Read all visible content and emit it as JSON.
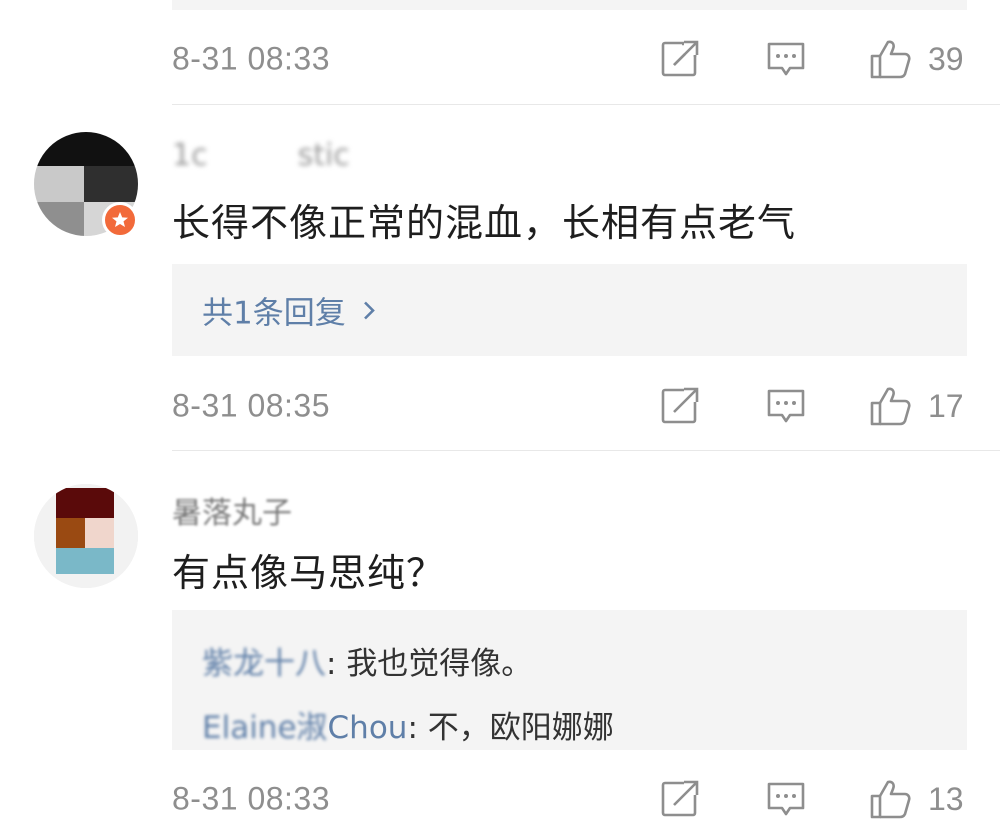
{
  "comments": [
    {
      "time": "8-31 08:33",
      "likes": "39"
    },
    {
      "username": "1c   stic",
      "text": "长得不像正常的混血，长相有点老气",
      "reply_summary": "共1条回复",
      "time": "8-31 08:35",
      "likes": "17"
    },
    {
      "username": "暑落丸子",
      "text": "有点像马思纯？",
      "replies": [
        {
          "author": "紫龙十八",
          "author_tail": "",
          "sep": ": ",
          "text": "我也觉得像。"
        },
        {
          "author": "Elaine淑",
          "author_tail": "Chou",
          "sep": ": ",
          "text": "不，欧阳娜娜"
        }
      ],
      "time": "8-31 08:33",
      "likes": "13"
    }
  ],
  "icons": {
    "share": "share-icon",
    "comment": "comment-icon",
    "like": "like-icon",
    "chevron": "chevron-right-icon",
    "verified": "verified-badge-icon"
  },
  "colors": {
    "meta": "#8e8e8e",
    "link": "#5f7fa8",
    "bubble": "#f4f4f4",
    "badge": "#f26a3a"
  }
}
